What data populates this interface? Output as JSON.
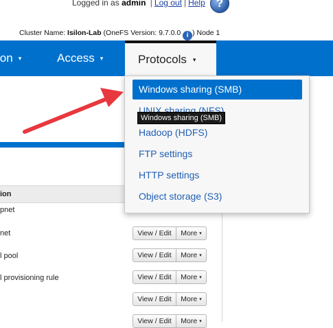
{
  "header": {
    "logged_in_prefix": "Logged in as",
    "username": "admin",
    "logout": "Log out",
    "help": "Help",
    "separator": "|",
    "help_icon_glyph": "?"
  },
  "cluster": {
    "label": "Cluster Name:",
    "name": "Isilon-Lab",
    "version": "(OneFS Version: 9.7.0.0",
    "info_icon_glyph": "i",
    "node": ") Node 1"
  },
  "nav": {
    "items": [
      {
        "label": "ion"
      },
      {
        "label": "Access"
      }
    ],
    "active": {
      "label": "Protocols"
    },
    "caret": "▾"
  },
  "table": {
    "header": "ion",
    "rows": [
      {
        "label": "pnet",
        "show_buttons": false
      },
      {
        "label": "net",
        "show_buttons": true
      },
      {
        "label": "l pool",
        "show_buttons": true
      },
      {
        "label": "l provisioning rule",
        "show_buttons": true
      },
      {
        "label": "",
        "show_buttons": true
      },
      {
        "label": "",
        "show_buttons": true
      }
    ],
    "view_edit": "View / Edit",
    "more": "More"
  },
  "dropdown": {
    "items": [
      "Windows sharing (SMB)",
      "UNIX sharing (NFS)",
      "Hadoop (HDFS)",
      "FTP settings",
      "HTTP settings",
      "Object storage (S3)"
    ],
    "selected_index": 0
  },
  "tooltip": {
    "text": "Windows sharing (SMB)"
  },
  "colors": {
    "nav_blue": "#0070cd",
    "link_blue": "#1f5fb4",
    "arrow_red": "#e8383f"
  }
}
